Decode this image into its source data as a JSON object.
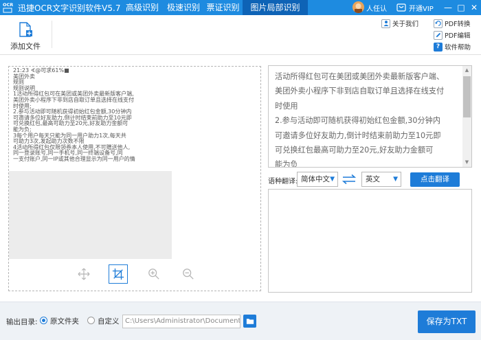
{
  "titlebar": {
    "logo_text": "OCR",
    "app_title": "迅捷OCR文字识别软件V5.7",
    "tabs": [
      {
        "label": "高级识别"
      },
      {
        "label": "极速识别"
      },
      {
        "label": "票证识别"
      },
      {
        "label": "图片局部识别",
        "active": true
      }
    ],
    "user_name": "人任认",
    "vip_label": "开通VIP",
    "window_buttons": [
      "—",
      "□",
      "✕"
    ]
  },
  "toolbar": {
    "add_file_label": "添加文件",
    "about_label": "关于我们",
    "pdf_convert_label": "PDF转换",
    "pdf_edit_label": "PDF编辑",
    "help_label": "软件帮助",
    "help_icon_glyph": "?"
  },
  "image_panel": {
    "lines": [
      "21:23 ∢@可求61%■",
      "美团外卖",
      "规则",
      "规则说明",
      "1活动所得红包可在美团或美团外卖最新版客户端,",
      "美团外卖小程序下非到店自取订单且选择在线支付",
      "时使用;",
      "2.参与活动即可随机获得初始红包金额,30分钟内",
      "可邀请多位好友助力,倒计时结束前助力至10元即",
      "可兑换红包,最高可助力至20元,好友助力金额可",
      "能为负;",
      "3每个用户每天只能为同一用户助力1次,每天共",
      "可助力3次,发起助力次数不限",
      "4活动所得红包仅限领券本人使用,不可赠送他人,",
      "同一登录账号,同一手机号,同一终端设备号,同",
      "一支付账户,同一IP或其他合理显示为同一用户的情"
    ]
  },
  "ocr_result": {
    "lines": [
      "活动所得红包可在美团或美团外卖最新版客户端、",
      "美团外卖小程序下非到店自取订单且选择在线支付",
      "时使用",
      "2.参与活动即可随机获得初始红包金额,30分钟内",
      "可邀请多位好友助力,倒计时结束前助力至10元即",
      "可兑换红包最高可助力至20元,好友助力金额可",
      "能为负"
    ]
  },
  "translation": {
    "label": "语种翻译:",
    "source_lang": "简体中文",
    "target_lang": "英文",
    "translate_button": "点击翻译"
  },
  "bottom": {
    "output_label": "输出目录:",
    "option_original": "原文件夹",
    "option_custom": "自定义",
    "path_value": "C:\\Users\\Administrator\\Documents",
    "save_button": "保存为TXT"
  },
  "colors": {
    "titlebar": "#1E8BE0",
    "active_tab": "#0E63B6",
    "accent": "#1E7CD8"
  }
}
